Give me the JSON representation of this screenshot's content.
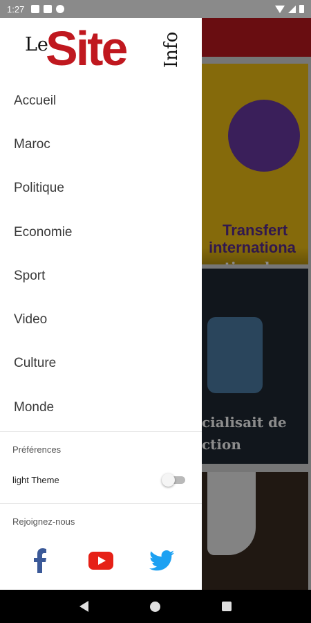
{
  "status_bar": {
    "time": "1:27",
    "icons": [
      "notification-a-icon",
      "youtube-notification-icon",
      "no-sim-icon",
      "wifi-icon",
      "signal-icon",
      "battery-icon"
    ]
  },
  "background_content": {
    "card1": {
      "headline_line1": "Transfert",
      "headline_line2": "internationa",
      "caption": "eption du"
    },
    "card2": {
      "caption_line1": "cialisait de",
      "caption_line2": "ction"
    }
  },
  "drawer": {
    "logo": {
      "le": "Le",
      "site": "Site",
      "info": "Info"
    },
    "menu": [
      "Accueil",
      "Maroc",
      "Politique",
      "Economie",
      "Sport",
      "Video",
      "Culture",
      "Monde"
    ],
    "preferences_label": "Préférences",
    "theme_label": "light Theme",
    "theme_enabled": false,
    "join_label": "Rejoignez-nous",
    "social": [
      {
        "name": "facebook",
        "icon": "facebook-icon",
        "color": "#3b5998"
      },
      {
        "name": "youtube",
        "icon": "youtube-icon",
        "color": "#e62117"
      },
      {
        "name": "twitter",
        "icon": "twitter-icon",
        "color": "#1da1f2"
      }
    ]
  },
  "colors": {
    "brand_red": "#c0181f",
    "status_bar": "#8a8a8a"
  }
}
